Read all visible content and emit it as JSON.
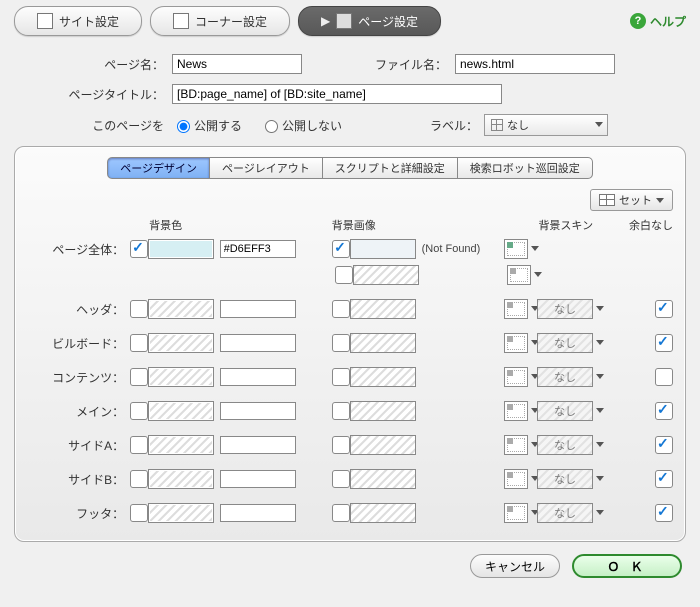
{
  "top_tabs": {
    "site": "サイト設定",
    "corner": "コーナー設定",
    "page": "ページ設定"
  },
  "help": "ヘルプ",
  "labels": {
    "page_name": "ページ名：",
    "file_name": "ファイル名：",
    "page_title": "ページタイトル：",
    "this_page": "このページを",
    "publish_yes": "公開する",
    "publish_no": "公開しない",
    "label_label": "ラベル：",
    "label_value": "なし"
  },
  "values": {
    "page_name": "News",
    "file_name": "news.html",
    "page_title": "[BD:page_name] of [BD:site_name]"
  },
  "subtabs": {
    "design": "ページデザイン",
    "layout": "ページレイアウト",
    "script": "スクリプトと詳細設定",
    "robot": "検索ロボット巡回設定"
  },
  "set_btn": "セット",
  "headers": {
    "bgcolor": "背景色",
    "bgimage": "背景画像",
    "bgskin": "背景スキン",
    "margin": "余白なし"
  },
  "rows": {
    "page_all": "ページ全体：",
    "header": "ヘッダ：",
    "billboard": "ビルボード：",
    "contents": "コンテンツ：",
    "main": "メイン：",
    "sideA": "サイドA：",
    "sideB": "サイドB：",
    "footer": "フッタ："
  },
  "hex_value": "#D6EFF3",
  "not_found": "(Not Found)",
  "skin_label": "なし",
  "buttons": {
    "cancel": "キャンセル",
    "ok": "Ｏ Ｋ"
  }
}
